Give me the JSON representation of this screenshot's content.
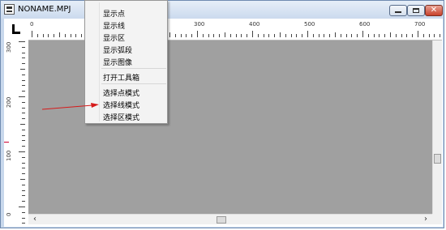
{
  "window": {
    "title": "NONAME.MPJ",
    "close_glyph": "✕"
  },
  "ruler": {
    "h_labels": [
      "0",
      "300",
      "400",
      "500",
      "600",
      "700"
    ],
    "v_labels": [
      "300",
      "200",
      "100",
      "0"
    ]
  },
  "context_menu": {
    "items": [
      "显示点",
      "显示线",
      "显示区",
      "显示弧段",
      "显示图像",
      "打开工具箱",
      "选择点模式",
      "选择线模式",
      "选择区模式"
    ]
  },
  "scrollbar": {
    "left_arrow": "‹",
    "right_arrow": "›"
  },
  "colors": {
    "canvas": "#a0a0a0",
    "annotation_arrow": "#d61b1b"
  }
}
